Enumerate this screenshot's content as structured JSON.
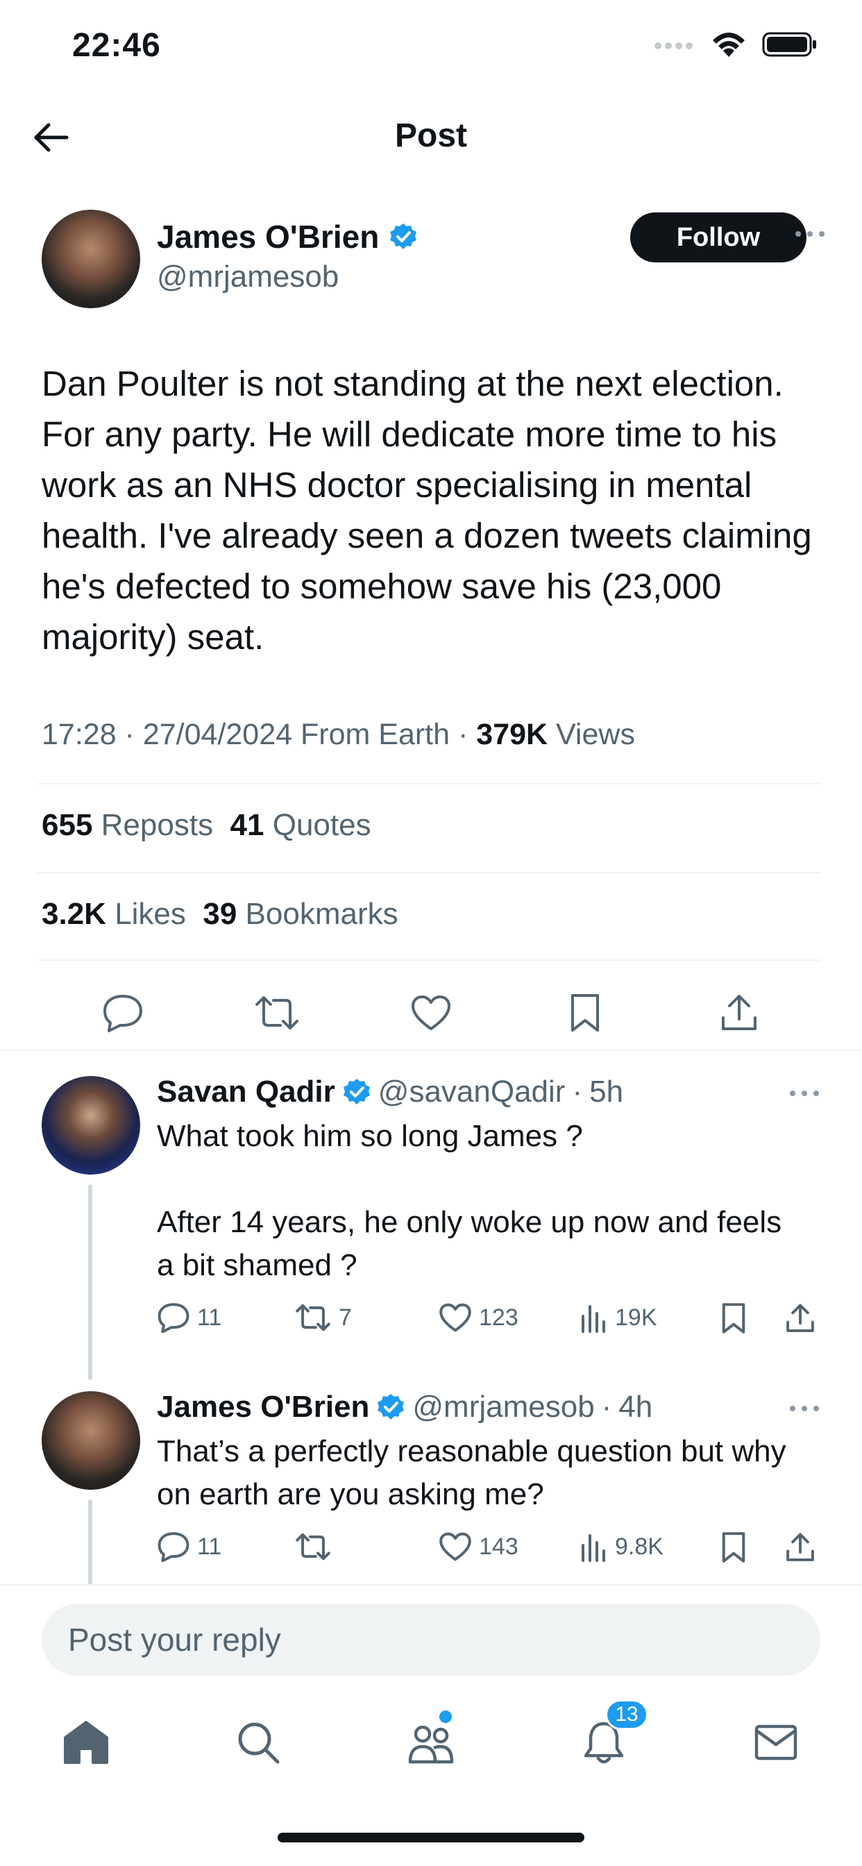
{
  "status_bar": {
    "time": "22:46"
  },
  "header": {
    "title": "Post"
  },
  "author": {
    "name": "James O'Brien",
    "handle": "@mrjamesob",
    "follow_label": "Follow"
  },
  "post": {
    "text": "Dan Poulter is not standing at the next election. For any party. He will dedicate more time to his work as an NHS doctor specialising in mental health. I've already seen a dozen tweets claiming he's defected to somehow save his (23,000 majority) seat.",
    "time": "17:28",
    "date": "27/04/2024",
    "source": "From Earth",
    "views_count": "379K",
    "views_label": "Views",
    "reposts_count": "655",
    "reposts_label": "Reposts",
    "quotes_count": "41",
    "quotes_label": "Quotes",
    "likes_count": "3.2K",
    "likes_label": "Likes",
    "bookmarks_count": "39",
    "bookmarks_label": "Bookmarks"
  },
  "replies": [
    {
      "name": "Savan Qadir",
      "handle": "@savanQadir",
      "time": "5h",
      "text": "What took him so long James ?\n\nAfter 14 years, he only woke up now and feels a bit shamed ?",
      "reply_count": "11",
      "repost_count": "7",
      "like_count": "123",
      "view_count": "19K"
    },
    {
      "name": "James O'Brien",
      "handle": "@mrjamesob",
      "time": "4h",
      "text": "That’s a perfectly reasonable question but why on earth are you asking me?",
      "reply_count": "11",
      "repost_count": "",
      "like_count": "143",
      "view_count": "9.8K"
    }
  ],
  "reply_bar": {
    "placeholder": "Post your reply"
  },
  "tab_bar": {
    "items": [
      "home-icon",
      "search-icon",
      "communities-icon",
      "notifications-icon",
      "messages-icon"
    ],
    "notifications_badge": "13"
  },
  "colors": {
    "accent": "#1d9bf0",
    "text": "#0f1419",
    "secondary": "#536471",
    "divider": "#eff3f4"
  }
}
